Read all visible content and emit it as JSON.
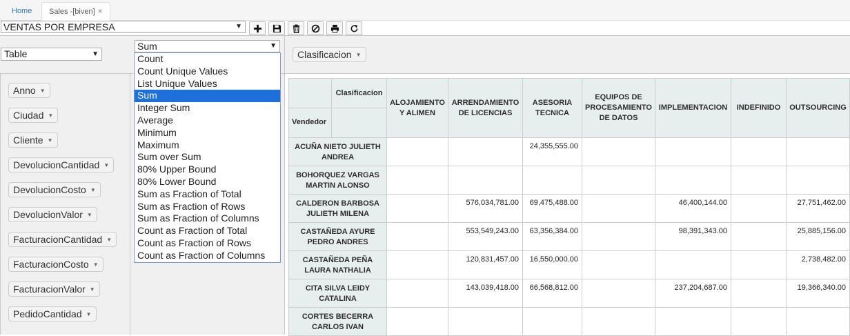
{
  "tabs": [
    {
      "label": "Home"
    },
    {
      "label": "Sales -[biven]",
      "close": "×"
    }
  ],
  "report": {
    "selected": "VENTAS POR EMPRESA"
  },
  "toolbar": {
    "buttons": [
      "plus-icon",
      "save-icon",
      "trash-icon",
      "ban-icon",
      "print-icon",
      "refresh-icon"
    ]
  },
  "renderer": {
    "selected": "Table"
  },
  "aggregator": {
    "selected": "Sum",
    "options": [
      "Count",
      "Count Unique Values",
      "List Unique Values",
      "Sum",
      "Integer Sum",
      "Average",
      "Minimum",
      "Maximum",
      "Sum over Sum",
      "80% Upper Bound",
      "80% Lower Bound",
      "Sum as Fraction of Total",
      "Sum as Fraction of Rows",
      "Sum as Fraction of Columns",
      "Count as Fraction of Total",
      "Count as Fraction of Rows",
      "Count as Fraction of Columns"
    ]
  },
  "col_attr": "Clasificacion",
  "attributes": [
    "Anno",
    "Ciudad",
    "Cliente",
    "DevolucionCantidad",
    "DevolucionCosto",
    "DevolucionValor",
    "FacturacionCantidad",
    "FacturacionCosto",
    "FacturacionValor",
    "PedidoCantidad"
  ],
  "table": {
    "col_attr_label": "Clasificacion",
    "row_attr_label": "Vendedor",
    "columns": [
      "ALOJAMIENTO Y ALIMEN",
      "ARRENDAMIENTO DE LICENCIAS",
      "ASESORIA TECNICA",
      "EQUIPOS DE PROCESAMIENTO DE DATOS",
      "IMPLEMENTACION",
      "INDEFINIDO",
      "OUTSOURCING"
    ],
    "rows": [
      {
        "name": "ACUÑA NIETO JULIETH ANDREA",
        "values": [
          "",
          "",
          "24,355,555.00",
          "",
          "",
          "",
          ""
        ]
      },
      {
        "name": "BOHORQUEZ VARGAS MARTIN ALONSO",
        "values": [
          "",
          "",
          "",
          "",
          "",
          "",
          ""
        ]
      },
      {
        "name": "CALDERON BARBOSA JULIETH MILENA",
        "values": [
          "",
          "576,034,781.00",
          "69,475,488.00",
          "",
          "46,400,144.00",
          "",
          "27,751,462.00"
        ]
      },
      {
        "name": "CASTAÑEDA AYURE PEDRO ANDRES",
        "values": [
          "",
          "553,549,243.00",
          "63,356,384.00",
          "",
          "98,391,343.00",
          "",
          "25,885,156.00"
        ]
      },
      {
        "name": "CASTAÑEDA PEÑA LAURA NATHALIA",
        "values": [
          "",
          "120,831,457.00",
          "16,550,000.00",
          "",
          "",
          "",
          "2,738,482.00"
        ]
      },
      {
        "name": "CITA SILVA LEIDY CATALINA",
        "values": [
          "",
          "143,039,418.00",
          "66,568,812.00",
          "",
          "237,204,687.00",
          "",
          "19,366,340.00"
        ]
      },
      {
        "name": "CORTES BECERRA CARLOS IVAN",
        "values": [
          "",
          "",
          "",
          "",
          "",
          "",
          ""
        ]
      }
    ]
  }
}
